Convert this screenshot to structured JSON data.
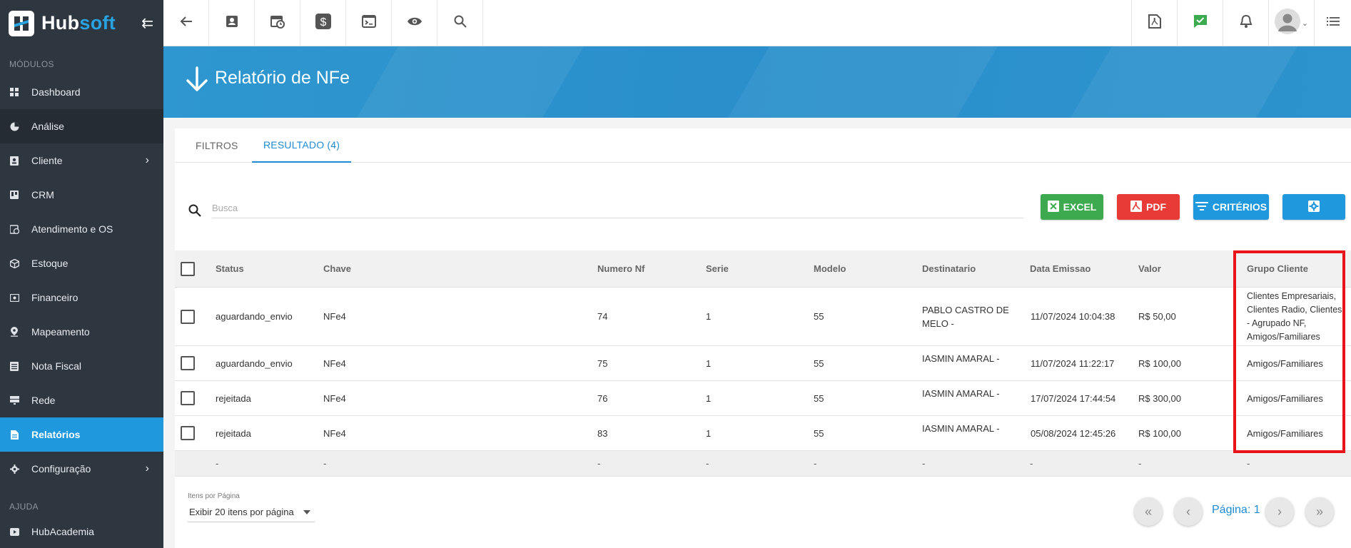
{
  "brand": {
    "name_part1": "Hub",
    "name_part2": "soft"
  },
  "sidebar": {
    "section_modules": "MÓDULOS",
    "items": [
      {
        "label": "Dashboard",
        "icon": "dashboard-icon"
      },
      {
        "label": "Análise",
        "icon": "pie-chart-icon"
      },
      {
        "label": "Cliente",
        "icon": "contact-card-icon"
      },
      {
        "label": "CRM",
        "icon": "board-icon"
      },
      {
        "label": "Atendimento e OS",
        "icon": "calendar-clock-icon"
      },
      {
        "label": "Estoque",
        "icon": "box-icon"
      },
      {
        "label": "Financeiro",
        "icon": "money-icon"
      },
      {
        "label": "Mapeamento",
        "icon": "map-pin-icon"
      },
      {
        "label": "Nota Fiscal",
        "icon": "invoice-icon"
      },
      {
        "label": "Rede",
        "icon": "server-icon"
      },
      {
        "label": "Relatórios",
        "icon": "report-icon"
      },
      {
        "label": "Configuração",
        "icon": "gear-icon"
      }
    ],
    "section_help": "AJUDA",
    "help_items": [
      {
        "label": "HubAcademia",
        "icon": "video-icon"
      }
    ]
  },
  "page": {
    "title": "Relatório de NFe"
  },
  "tabs": [
    {
      "label": "FILTROS"
    },
    {
      "label": "RESULTADO (4)"
    }
  ],
  "search": {
    "placeholder": "Busca"
  },
  "actions": {
    "excel": "EXCEL",
    "pdf": "PDF",
    "criterios": "CRITÉRIOS"
  },
  "colors": {
    "sidebar": "#2e3640",
    "accent": "#1f98dd",
    "excel": "#3daa4f",
    "pdf": "#e83a37",
    "highlight": "#e8141a"
  },
  "table": {
    "columns": [
      "Status",
      "Chave",
      "Numero Nf",
      "Serie",
      "Modelo",
      "Destinatario",
      "Data Emissao",
      "Valor",
      "Grupo Cliente"
    ],
    "rows": [
      {
        "status": "aguardando_envio",
        "chave": "NFe4",
        "numero": "74",
        "serie": "1",
        "modelo": "55",
        "destinatario_line1": "PABLO CASTRO DE",
        "destinatario_line2": "MELO -",
        "data": "11/07/2024 10:04:38",
        "valor": "R$ 50,00",
        "grupo_lines": [
          "Clientes Empresariais,",
          "Clientes Radio, Clientes",
          "- Agrupado NF,",
          "Amigos/Familiares"
        ]
      },
      {
        "status": "aguardando_envio",
        "chave": "NFe4",
        "numero": "75",
        "serie": "1",
        "modelo": "55",
        "destinatario_line1": "IASMIN AMARAL -",
        "data": "11/07/2024 11:22:17",
        "valor": "R$ 100,00",
        "grupo": "Amigos/Familiares"
      },
      {
        "status": "rejeitada",
        "chave": "NFe4",
        "numero": "76",
        "serie": "1",
        "modelo": "55",
        "destinatario_line1": "IASMIN AMARAL -",
        "data": "17/07/2024 17:44:54",
        "valor": "R$ 300,00",
        "grupo": "Amigos/Familiares"
      },
      {
        "status": "rejeitada",
        "chave": "NFe4",
        "numero": "83",
        "serie": "1",
        "modelo": "55",
        "destinatario_line1": "IASMIN AMARAL -",
        "data": "05/08/2024 12:45:26",
        "valor": "R$ 100,00",
        "grupo": "Amigos/Familiares"
      }
    ],
    "footer_placeholder": "-"
  },
  "pagination": {
    "per_page_label": "Itens por Página",
    "per_page_value": "Exibir 20 itens por página",
    "page_label": "Página: 1"
  }
}
